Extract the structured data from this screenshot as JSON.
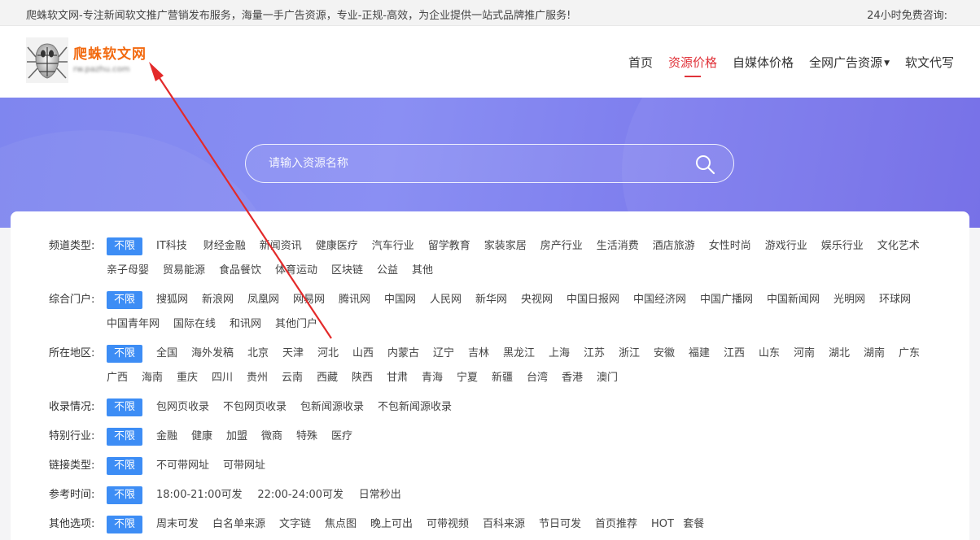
{
  "topbar": {
    "notice": "爬蛛软文网-专注新闻软文推广营销发布服务，海量一手广告资源，专业-正规-高效，为企业提供一站式品牌推广服务!",
    "hotline_label": "24小时免费咨询:"
  },
  "logo": {
    "brand": "爬蛛软文网",
    "domain": "rw.pazhu.com"
  },
  "nav": [
    {
      "label": "首页",
      "active": false,
      "dropdown": false
    },
    {
      "label": "资源价格",
      "active": true,
      "dropdown": false
    },
    {
      "label": "自媒体价格",
      "active": false,
      "dropdown": false
    },
    {
      "label": "全网广告资源",
      "active": false,
      "dropdown": true
    },
    {
      "label": "软文代写",
      "active": false,
      "dropdown": false
    }
  ],
  "search": {
    "placeholder": "请输入资源名称",
    "icon": "search-icon"
  },
  "colors": {
    "accent_red": "#e0333a",
    "selected_blue": "#3d8df5",
    "brand_orange": "#f26a10",
    "hero_purple": "#7f86ef",
    "annotation_arrow": "#e32a2a"
  },
  "filters": [
    {
      "label": "频道类型:",
      "options": [
        "不限",
        "IT科技",
        "财经金融",
        "新闻资讯",
        "健康医疗",
        "汽车行业",
        "留学教育",
        "家装家居",
        "房产行业",
        "生活消费",
        "酒店旅游",
        "女性时尚",
        "游戏行业",
        "娱乐行业",
        "文化艺术",
        "亲子母婴",
        "贸易能源",
        "食品餐饮",
        "体育运动",
        "区块链",
        "公益",
        "其他"
      ],
      "selected": 0
    },
    {
      "label": "综合门户:",
      "options": [
        "不限",
        "搜狐网",
        "新浪网",
        "凤凰网",
        "网易网",
        "腾讯网",
        "中国网",
        "人民网",
        "新华网",
        "央视网",
        "中国日报网",
        "中国经济网",
        "中国广播网",
        "中国新闻网",
        "光明网",
        "环球网",
        "中国青年网",
        "国际在线",
        "和讯网",
        "其他门户"
      ],
      "selected": 0
    },
    {
      "label": "所在地区:",
      "options": [
        "不限",
        "全国",
        "海外发稿",
        "北京",
        "天津",
        "河北",
        "山西",
        "内蒙古",
        "辽宁",
        "吉林",
        "黑龙江",
        "上海",
        "江苏",
        "浙江",
        "安徽",
        "福建",
        "江西",
        "山东",
        "河南",
        "湖北",
        "湖南",
        "广东",
        "广西",
        "海南",
        "重庆",
        "四川",
        "贵州",
        "云南",
        "西藏",
        "陕西",
        "甘肃",
        "青海",
        "宁夏",
        "新疆",
        "台湾",
        "香港",
        "澳门"
      ],
      "selected": 0
    },
    {
      "label": "收录情况:",
      "options": [
        "不限",
        "包网页收录",
        "不包网页收录",
        "包新闻源收录",
        "不包新闻源收录"
      ],
      "selected": 0
    },
    {
      "label": "特别行业:",
      "options": [
        "不限",
        "金融",
        "健康",
        "加盟",
        "微商",
        "特殊",
        "医疗"
      ],
      "selected": 0
    },
    {
      "label": "链接类型:",
      "options": [
        "不限",
        "不可带网址",
        "可带网址"
      ],
      "selected": 0
    },
    {
      "label": "参考时间:",
      "options": [
        "不限",
        "18:00-21:00可发",
        "22:00-24:00可发",
        "日常秒出"
      ],
      "selected": 0
    },
    {
      "label": "其他选项:",
      "options": [
        "不限",
        "周末可发",
        "白名单来源",
        "文字链",
        "焦点图",
        "晚上可出",
        "可带视频",
        "百科来源",
        "节日可发",
        "首页推荐",
        "HOT",
        "套餐"
      ],
      "selected": 0
    }
  ]
}
